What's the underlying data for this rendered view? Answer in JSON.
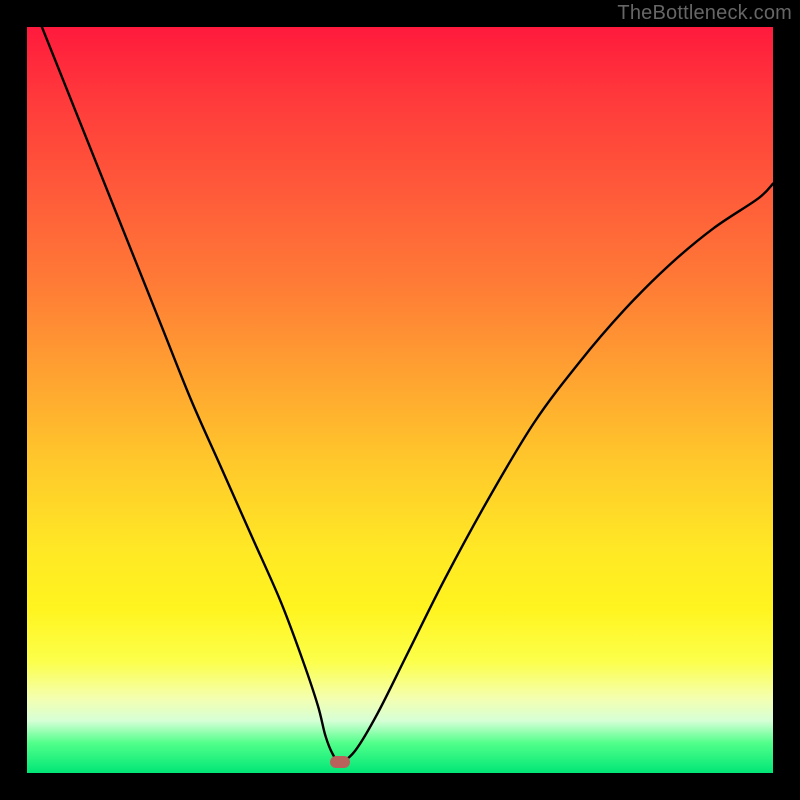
{
  "watermark": "TheBottleneck.com",
  "colors": {
    "frame": "#000000",
    "watermark": "#666666",
    "curve": "#000000",
    "marker": "#b9625b",
    "gradient_top": "#ff1a3d",
    "gradient_bottom": "#00e676"
  },
  "chart_data": {
    "type": "line",
    "title": "",
    "xlabel": "",
    "ylabel": "",
    "xlim": [
      0,
      100
    ],
    "ylim": [
      0,
      100
    ],
    "grid": false,
    "legend": false,
    "annotations": [
      {
        "kind": "marker",
        "x": 42,
        "y": 1.5,
        "shape": "rounded-rect"
      }
    ],
    "series": [
      {
        "name": "bottleneck-curve",
        "x": [
          2,
          6,
          10,
          14,
          18,
          22,
          26,
          30,
          34,
          37,
          39,
          40,
          41,
          42,
          44,
          47,
          51,
          56,
          62,
          68,
          74,
          80,
          86,
          92,
          98,
          100
        ],
        "y": [
          100,
          90,
          80,
          70,
          60,
          50,
          41,
          32,
          23,
          15,
          9,
          5,
          2.5,
          1.5,
          3,
          8,
          16,
          26,
          37,
          47,
          55,
          62,
          68,
          73,
          77,
          79
        ]
      }
    ]
  }
}
